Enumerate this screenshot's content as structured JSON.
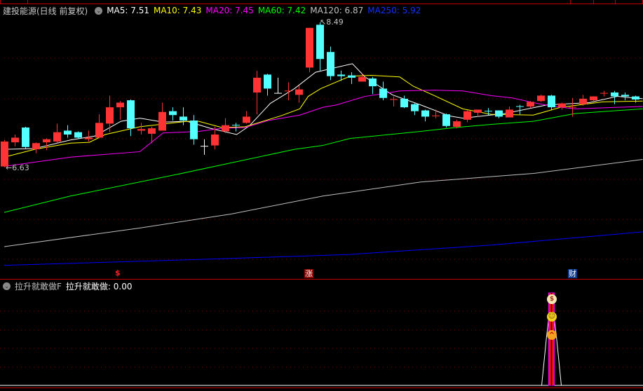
{
  "stock": {
    "name": "建投能源(日线 前复权)"
  },
  "ma_labels": [
    {
      "label": "MA5: 7.51",
      "color": "#ffffff"
    },
    {
      "label": "MA10: 7.43",
      "color": "#ffff00"
    },
    {
      "label": "MA20: 7.45",
      "color": "#ff00ff"
    },
    {
      "label": "MA60: 7.42",
      "color": "#00ff00"
    },
    {
      "label": "MA120: 6.87",
      "color": "#c0c0c0"
    },
    {
      "label": "MA250: 5.92",
      "color": "#0000ff"
    }
  ],
  "indicator": {
    "name": "拉升就敢做F",
    "value_label": "拉升就敢做: 0.00"
  },
  "markers": {
    "dollar": "$",
    "zhang": "涨",
    "cai": "财"
  },
  "annotations": {
    "high": "8.49",
    "low": "6.63"
  },
  "colors": {
    "up": "#ff3333",
    "down": "#54ffff",
    "doji": "#ffffff",
    "grid": "#8b0000",
    "separator": "#c00000"
  },
  "chart_data": {
    "type": "candlestick",
    "ylim": [
      5.25,
      8.58
    ],
    "ohlc": [
      [
        6.64,
        6.98,
        6.63,
        6.96
      ],
      [
        6.95,
        7.05,
        6.9,
        7.01
      ],
      [
        7.14,
        7.15,
        6.87,
        6.89
      ],
      [
        6.86,
        6.95,
        6.81,
        6.94
      ],
      [
        6.95,
        7.0,
        6.85,
        6.99
      ],
      [
        6.96,
        7.19,
        6.94,
        7.08
      ],
      [
        7.1,
        7.17,
        7.01,
        7.05
      ],
      [
        7.08,
        7.09,
        6.99,
        7.01
      ],
      [
        6.99,
        7.1,
        6.96,
        7.01
      ],
      [
        7.01,
        7.31,
        7.0,
        7.2
      ],
      [
        7.19,
        7.55,
        7.08,
        7.4
      ],
      [
        7.4,
        7.48,
        7.24,
        7.46
      ],
      [
        7.49,
        7.5,
        7.03,
        7.13
      ],
      [
        7.1,
        7.2,
        7.05,
        7.12
      ],
      [
        7.06,
        7.15,
        6.94,
        7.13
      ],
      [
        7.1,
        7.46,
        7.1,
        7.34
      ],
      [
        7.35,
        7.4,
        7.23,
        7.3
      ],
      [
        7.28,
        7.4,
        7.17,
        7.23
      ],
      [
        7.23,
        7.3,
        6.92,
        6.99
      ],
      [
        6.9,
        6.99,
        6.79,
        6.9
      ],
      [
        6.91,
        7.15,
        6.86,
        7.05
      ],
      [
        7.09,
        7.26,
        7.07,
        7.17
      ],
      [
        7.17,
        7.2,
        7.09,
        7.16
      ],
      [
        7.2,
        7.35,
        7.19,
        7.28
      ],
      [
        7.59,
        7.87,
        7.31,
        7.78
      ],
      [
        7.82,
        7.83,
        7.55,
        7.64
      ],
      [
        7.58,
        7.78,
        7.58,
        7.58
      ],
      [
        7.61,
        7.72,
        7.49,
        7.61
      ],
      [
        7.56,
        7.68,
        7.46,
        7.63
      ],
      [
        7.91,
        8.42,
        7.85,
        8.42
      ],
      [
        8.46,
        8.49,
        7.87,
        8.02
      ],
      [
        8.11,
        8.18,
        7.75,
        7.8
      ],
      [
        7.82,
        7.87,
        7.74,
        7.8
      ],
      [
        7.81,
        7.85,
        7.7,
        7.78
      ],
      [
        7.73,
        7.83,
        7.73,
        7.79
      ],
      [
        7.77,
        7.79,
        7.57,
        7.67
      ],
      [
        7.64,
        7.73,
        7.49,
        7.52
      ],
      [
        7.49,
        7.54,
        7.41,
        7.5
      ],
      [
        7.51,
        7.55,
        7.39,
        7.4
      ],
      [
        7.44,
        7.45,
        7.3,
        7.35
      ],
      [
        7.36,
        7.37,
        7.22,
        7.28
      ],
      [
        7.28,
        7.37,
        7.26,
        7.29
      ],
      [
        7.31,
        7.32,
        7.14,
        7.16
      ],
      [
        7.15,
        7.24,
        7.13,
        7.22
      ],
      [
        7.24,
        7.36,
        7.21,
        7.35
      ],
      [
        7.33,
        7.37,
        7.28,
        7.37
      ],
      [
        7.35,
        7.39,
        7.3,
        7.34
      ],
      [
        7.36,
        7.36,
        7.26,
        7.28
      ],
      [
        7.27,
        7.41,
        7.27,
        7.37
      ],
      [
        7.41,
        7.43,
        7.31,
        7.4
      ],
      [
        7.41,
        7.48,
        7.39,
        7.47
      ],
      [
        7.48,
        7.56,
        7.47,
        7.55
      ],
      [
        7.55,
        7.56,
        7.37,
        7.4
      ],
      [
        7.4,
        7.46,
        7.37,
        7.45
      ],
      [
        7.39,
        7.52,
        7.28,
        7.4
      ],
      [
        7.44,
        7.56,
        7.42,
        7.51
      ],
      [
        7.49,
        7.54,
        7.46,
        7.54
      ],
      [
        7.57,
        7.61,
        7.54,
        7.58
      ],
      [
        7.59,
        7.61,
        7.44,
        7.54
      ],
      [
        7.56,
        7.59,
        7.49,
        7.54
      ],
      [
        7.54,
        7.55,
        7.46,
        7.5
      ]
    ],
    "ma": [
      {
        "name": "MA5",
        "color": "#ffffff",
        "points": [
          [
            0,
            6.86
          ],
          [
            2.9,
            6.87
          ],
          [
            6.3,
            6.98
          ],
          [
            8.6,
            7.03
          ],
          [
            11.1,
            7.22
          ],
          [
            12.9,
            7.26
          ],
          [
            15.1,
            7.21
          ],
          [
            17.4,
            7.22
          ],
          [
            19.6,
            7.13
          ],
          [
            22.1,
            7.05
          ],
          [
            23.3,
            7.16
          ],
          [
            25.3,
            7.45
          ],
          [
            27.6,
            7.64
          ],
          [
            29.6,
            7.85
          ],
          [
            33.1,
            7.96
          ],
          [
            34.3,
            7.79
          ],
          [
            36.9,
            7.56
          ],
          [
            39.6,
            7.43
          ],
          [
            42.3,
            7.29
          ],
          [
            43.6,
            7.26
          ],
          [
            47.6,
            7.32
          ],
          [
            51.6,
            7.43
          ],
          [
            55.6,
            7.46
          ],
          [
            58.3,
            7.54
          ],
          [
            60.7,
            7.51
          ]
        ]
      },
      {
        "name": "MA10",
        "color": "#ffff00",
        "points": [
          [
            0,
            6.76
          ],
          [
            2.9,
            6.86
          ],
          [
            6.3,
            6.94
          ],
          [
            8.1,
            6.95
          ],
          [
            9.6,
            7.05
          ],
          [
            12.9,
            7.15
          ],
          [
            17.4,
            7.22
          ],
          [
            18.5,
            7.22
          ],
          [
            20.7,
            7.14
          ],
          [
            22.9,
            7.15
          ],
          [
            26.3,
            7.29
          ],
          [
            28.1,
            7.38
          ],
          [
            28.9,
            7.54
          ],
          [
            30.1,
            7.64
          ],
          [
            32.9,
            7.8
          ],
          [
            34.9,
            7.81
          ],
          [
            37.6,
            7.79
          ],
          [
            38.9,
            7.67
          ],
          [
            40.9,
            7.55
          ],
          [
            43.6,
            7.38
          ],
          [
            46.3,
            7.31
          ],
          [
            50.3,
            7.3
          ],
          [
            52.9,
            7.4
          ],
          [
            56.9,
            7.47
          ],
          [
            60.7,
            7.48
          ]
        ]
      },
      {
        "name": "MA20",
        "color": "#ff00ff",
        "points": [
          [
            0,
            6.64
          ],
          [
            6.3,
            6.76
          ],
          [
            12.9,
            6.83
          ],
          [
            15.1,
            7.07
          ],
          [
            18.5,
            7.09
          ],
          [
            20.7,
            7.13
          ],
          [
            22.9,
            7.14
          ],
          [
            25.1,
            7.23
          ],
          [
            28.1,
            7.3
          ],
          [
            30.3,
            7.4
          ],
          [
            31.6,
            7.43
          ],
          [
            34.3,
            7.54
          ],
          [
            36.3,
            7.58
          ],
          [
            37.6,
            7.61
          ],
          [
            40.9,
            7.62
          ],
          [
            43.6,
            7.61
          ],
          [
            46.3,
            7.55
          ],
          [
            48.3,
            7.52
          ],
          [
            50.3,
            7.46
          ],
          [
            52.3,
            7.41
          ],
          [
            54.3,
            7.38
          ],
          [
            58.3,
            7.4
          ],
          [
            60.7,
            7.41
          ]
        ]
      },
      {
        "name": "MA60",
        "color": "#00ff00",
        "points": [
          [
            0,
            6.05
          ],
          [
            6.3,
            6.26
          ],
          [
            16.5,
            6.54
          ],
          [
            27.6,
            6.86
          ],
          [
            30.3,
            6.91
          ],
          [
            32.9,
            7.0
          ],
          [
            39.6,
            7.09
          ],
          [
            42.9,
            7.14
          ],
          [
            46.3,
            7.18
          ],
          [
            50.3,
            7.22
          ],
          [
            54.3,
            7.32
          ],
          [
            60.7,
            7.38
          ]
        ]
      },
      {
        "name": "MA120",
        "color": "#c0c0c0",
        "points": [
          [
            0,
            5.61
          ],
          [
            12.9,
            5.85
          ],
          [
            21.6,
            6.03
          ],
          [
            30.3,
            6.26
          ],
          [
            39.6,
            6.44
          ],
          [
            50.3,
            6.55
          ],
          [
            60.7,
            6.73
          ]
        ]
      },
      {
        "name": "MA250",
        "color": "#0000ff",
        "points": [
          [
            0,
            5.37
          ],
          [
            19.6,
            5.45
          ],
          [
            32.9,
            5.51
          ],
          [
            46.3,
            5.63
          ],
          [
            60.7,
            5.8
          ]
        ]
      }
    ],
    "indicator_series": {
      "signal_index": 52,
      "value_at_signal": 1,
      "ylim": [
        0,
        1
      ]
    }
  }
}
